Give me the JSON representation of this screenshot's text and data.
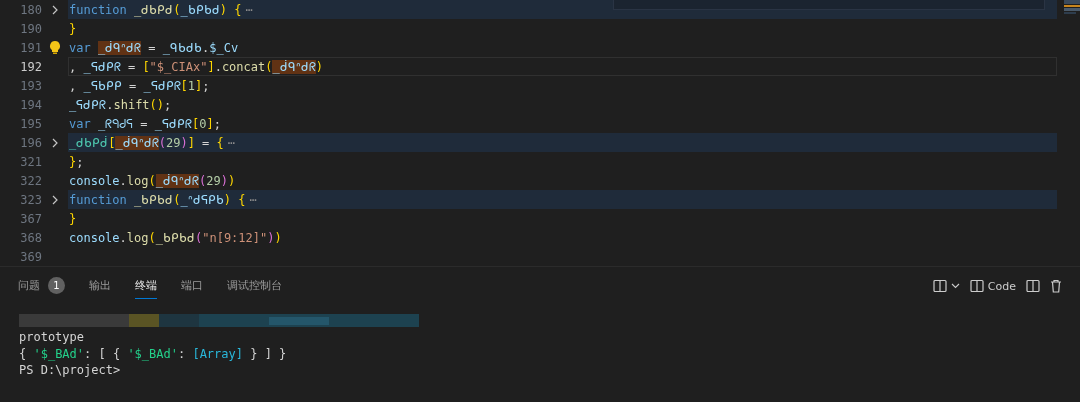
{
  "editor": {
    "lines": [
      {
        "number": "180",
        "folded": true,
        "current": false,
        "tokens": [
          {
            "t": "function ",
            "kind": "kw"
          },
          {
            "t": "_ᑯᑲᑭᑯ",
            "kind": "fn"
          },
          {
            "t": "(",
            "kind": "b1"
          },
          {
            "t": "_ᑲᑭᑲᑯ",
            "kind": "var"
          },
          {
            "t": ")",
            "kind": "b1"
          },
          {
            "t": " {",
            "kind": "b1"
          }
        ]
      },
      {
        "number": "190",
        "folded": false,
        "current": false,
        "tokens": [
          {
            "t": "}",
            "kind": "b1"
          }
        ]
      },
      {
        "number": "191",
        "folded": false,
        "current": false,
        "bulb": true,
        "tokens": [
          {
            "t": "var ",
            "kind": "kw"
          },
          {
            "t": "_ᑰᑫᐢᑯᖇ",
            "kind": "hl"
          },
          {
            "t": " = ",
            "kind": "plain"
          },
          {
            "t": "_ᑫᑲᑯᑲ",
            "kind": "var"
          },
          {
            "t": ".",
            "kind": "plain"
          },
          {
            "t": "$_Cv",
            "kind": "var"
          }
        ]
      },
      {
        "number": "192",
        "folded": false,
        "current": true,
        "tokens": [
          {
            "t": ", ",
            "kind": "plain"
          },
          {
            "t": "_ᕋᑯᑭᖇ",
            "kind": "var"
          },
          {
            "t": " = ",
            "kind": "plain"
          },
          {
            "t": "[",
            "kind": "b1"
          },
          {
            "t": "\"$_CIAx\"",
            "kind": "str"
          },
          {
            "t": "]",
            "kind": "b1"
          },
          {
            "t": ".",
            "kind": "plain"
          },
          {
            "t": "concat",
            "kind": "fn"
          },
          {
            "t": "(",
            "kind": "b1"
          },
          {
            "t": "_ᑰᑫᐢᑯᖇ",
            "kind": "hl"
          },
          {
            "t": ")",
            "kind": "b1"
          }
        ]
      },
      {
        "number": "193",
        "folded": false,
        "current": false,
        "tokens": [
          {
            "t": ", ",
            "kind": "plain"
          },
          {
            "t": "_ᕋᑲᑭᑭ",
            "kind": "var"
          },
          {
            "t": " = ",
            "kind": "plain"
          },
          {
            "t": "_ᕋᑯᑭᖇ",
            "kind": "var"
          },
          {
            "t": "[",
            "kind": "b1"
          },
          {
            "t": "1",
            "kind": "num"
          },
          {
            "t": "]",
            "kind": "b1"
          },
          {
            "t": ";",
            "kind": "plain"
          }
        ]
      },
      {
        "number": "194",
        "folded": false,
        "current": false,
        "tokens": [
          {
            "t": "_ᕋᑯᑭᖇ",
            "kind": "var"
          },
          {
            "t": ".",
            "kind": "plain"
          },
          {
            "t": "shift",
            "kind": "fn"
          },
          {
            "t": "()",
            "kind": "b1"
          },
          {
            "t": ";",
            "kind": "plain"
          }
        ]
      },
      {
        "number": "195",
        "folded": false,
        "current": false,
        "tokens": [
          {
            "t": "var ",
            "kind": "kw"
          },
          {
            "t": "_ᖇᑫᑯᕋ",
            "kind": "var"
          },
          {
            "t": " = ",
            "kind": "plain"
          },
          {
            "t": "_ᕋᑯᑭᖇ",
            "kind": "var"
          },
          {
            "t": "[",
            "kind": "b1"
          },
          {
            "t": "0",
            "kind": "num"
          },
          {
            "t": "]",
            "kind": "b1"
          },
          {
            "t": ";",
            "kind": "plain"
          }
        ]
      },
      {
        "number": "196",
        "folded": true,
        "current": false,
        "tokens": [
          {
            "t": "_ᑯᑲᑭᑰ",
            "kind": "cls"
          },
          {
            "t": "[",
            "kind": "b1"
          },
          {
            "t": "_ᑰᑫᐢᑯᖇ",
            "kind": "hl"
          },
          {
            "t": "(",
            "kind": "b2"
          },
          {
            "t": "29",
            "kind": "num"
          },
          {
            "t": ")",
            "kind": "b2"
          },
          {
            "t": "]",
            "kind": "b1"
          },
          {
            "t": " = ",
            "kind": "plain"
          },
          {
            "t": "{",
            "kind": "b1"
          }
        ]
      },
      {
        "number": "321",
        "folded": false,
        "current": false,
        "tokens": [
          {
            "t": "}",
            "kind": "b1"
          },
          {
            "t": ";",
            "kind": "plain"
          }
        ]
      },
      {
        "number": "322",
        "folded": false,
        "current": false,
        "tokens": [
          {
            "t": "console",
            "kind": "var"
          },
          {
            "t": ".",
            "kind": "plain"
          },
          {
            "t": "log",
            "kind": "fn"
          },
          {
            "t": "(",
            "kind": "b1"
          },
          {
            "t": "_ᑰᑫᐢᑯᖇ",
            "kind": "hl"
          },
          {
            "t": "(",
            "kind": "b2"
          },
          {
            "t": "29",
            "kind": "num"
          },
          {
            "t": ")",
            "kind": "b2"
          },
          {
            "t": ")",
            "kind": "b1"
          }
        ]
      },
      {
        "number": "323",
        "folded": true,
        "current": false,
        "tokens": [
          {
            "t": "function ",
            "kind": "kw"
          },
          {
            "t": "_ᑲᑭᑲᑯ",
            "kind": "fn"
          },
          {
            "t": "(",
            "kind": "b1"
          },
          {
            "t": "_ᐢᑯᕋᑭᑲ",
            "kind": "var"
          },
          {
            "t": ")",
            "kind": "b1"
          },
          {
            "t": " {",
            "kind": "b1"
          }
        ]
      },
      {
        "number": "367",
        "folded": false,
        "current": false,
        "tokens": [
          {
            "t": "}",
            "kind": "b1"
          }
        ]
      },
      {
        "number": "368",
        "folded": false,
        "current": false,
        "tokens": [
          {
            "t": "console",
            "kind": "var"
          },
          {
            "t": ".",
            "kind": "plain"
          },
          {
            "t": "log",
            "kind": "fn"
          },
          {
            "t": "(",
            "kind": "b1"
          },
          {
            "t": "_ᑲᑭᑲᑯ",
            "kind": "fn"
          },
          {
            "t": "(",
            "kind": "b2"
          },
          {
            "t": "\"n[9:12]\"",
            "kind": "str"
          },
          {
            "t": ")",
            "kind": "b2"
          },
          {
            "t": ")",
            "kind": "b1"
          }
        ]
      },
      {
        "number": "369",
        "folded": false,
        "current": false
      }
    ],
    "fold_ellipsis": "⋯"
  },
  "panel": {
    "tabs": [
      {
        "label": "问题",
        "selected": false,
        "badge": "1"
      },
      {
        "label": "输出",
        "selected": false
      },
      {
        "label": "终端",
        "selected": true
      },
      {
        "label": "端口",
        "selected": false
      },
      {
        "label": "调试控制台",
        "selected": false
      }
    ],
    "terminal_name": "Code",
    "terminal_lines": [
      {
        "tokens": [
          {
            "t": "prototype",
            "kind": "plain"
          }
        ]
      },
      {
        "tokens": [
          {
            "t": "{ ",
            "kind": "plain"
          },
          {
            "t": "'$_BAd'",
            "kind": "tstr"
          },
          {
            "t": ": [ { ",
            "kind": "plain"
          },
          {
            "t": "'$_BAd'",
            "kind": "tstr"
          },
          {
            "t": ": ",
            "kind": "plain"
          },
          {
            "t": "[Array]",
            "kind": "tarr"
          },
          {
            "t": " } ] }",
            "kind": "plain"
          }
        ]
      },
      {
        "tokens": [
          {
            "t": "PS D:\\project>",
            "kind": "plain"
          }
        ]
      }
    ]
  }
}
